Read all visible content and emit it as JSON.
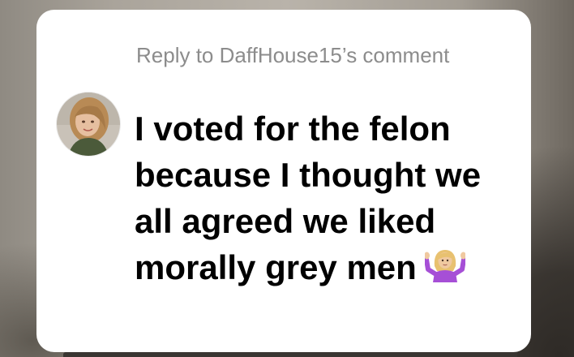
{
  "reply": {
    "label": "Reply to DaffHouse15’s comment"
  },
  "comment": {
    "text": "I voted for the felon because I thought we all agreed we liked morally grey men",
    "emoji": "person-shrugging-emoji"
  },
  "icons": {
    "back": "chevron-left-icon",
    "avatar": "user-avatar"
  },
  "colors": {
    "card_background": "#ffffff",
    "reply_text": "#8c8c8c",
    "comment_text": "#000000",
    "back_chevron": "#ffffff",
    "emoji_shirt": "#a64fd6",
    "emoji_skin": "#f0c9a0",
    "emoji_hair": "#e8c170"
  }
}
